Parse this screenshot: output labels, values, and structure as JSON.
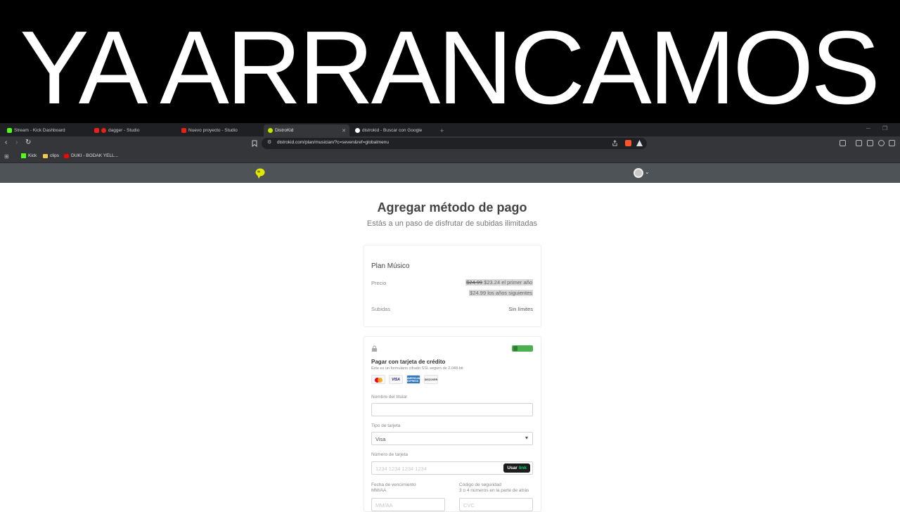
{
  "banner": {
    "text": "YA ARRANCAMOS"
  },
  "browser": {
    "tabs": [
      {
        "label": "Stream - Kick Dashboard",
        "icon": "kick-icon",
        "color": "#53fc18"
      },
      {
        "label": "dagger - Studio",
        "icon": "youtube-studio-icon",
        "color": "#e62117"
      },
      {
        "label": "Nuevo proyecto - Studio",
        "icon": "youtube-studio-icon",
        "color": "#e62117"
      },
      {
        "label": "DistroKid",
        "icon": "distrokid-icon",
        "color": "#c2e800"
      },
      {
        "label": "distrokid - Buscar con Google",
        "icon": "google-icon",
        "color": "#ffffff"
      }
    ],
    "new_tab": "+",
    "url": "distrokid.com/plan/musician/?c=seven&ref=globalmenu",
    "bookmarks": [
      {
        "label": "Kick",
        "icon": "kick-icon"
      },
      {
        "label": "clips",
        "icon": "folder-icon"
      },
      {
        "label": "DUKI - BODAK YELL...",
        "icon": "youtube-icon"
      }
    ]
  },
  "page": {
    "title": "Agregar método de pago",
    "subtitle": "Estás a un paso de disfrutar de subidas ilimitadas",
    "plan": {
      "name": "Plan Músico",
      "price_label": "Precio",
      "old_price": "$24.99",
      "first_year": "$23.24 el primer año",
      "following_years": "$24.99 los años siguientes",
      "uploads_label": "Subidas",
      "uploads_value": "Sin límites"
    },
    "payment": {
      "title": "Pagar con tarjeta de crédito",
      "note": "Este es un formulario cifrado SSL seguro de 2.048-bit",
      "cards": [
        "mastercard-icon",
        "visa-icon",
        "amex-icon",
        "discover-icon"
      ],
      "visa_text": "VISA",
      "amex_text": "AMERICAN EXPRESS",
      "discover_text": "DISCOVER",
      "holder_label": "Nombre del titular",
      "holder_value": "",
      "card_type_label": "Tipo de tarjeta",
      "card_type_value": "Visa",
      "card_number_label": "Número de tarjeta",
      "card_number_placeholder": "1234 1234 1234 1234",
      "link_button_prefix": "Usar",
      "link_button_brand": "link",
      "expiry_label": "Fecha de vencimiento",
      "expiry_sub": "MM/AA",
      "expiry_placeholder": "MM/AA",
      "cvc_label": "Código de seguridad",
      "cvc_sub": "3 o 4 números en la parte de atrás",
      "cvc_placeholder": "CVC"
    }
  }
}
